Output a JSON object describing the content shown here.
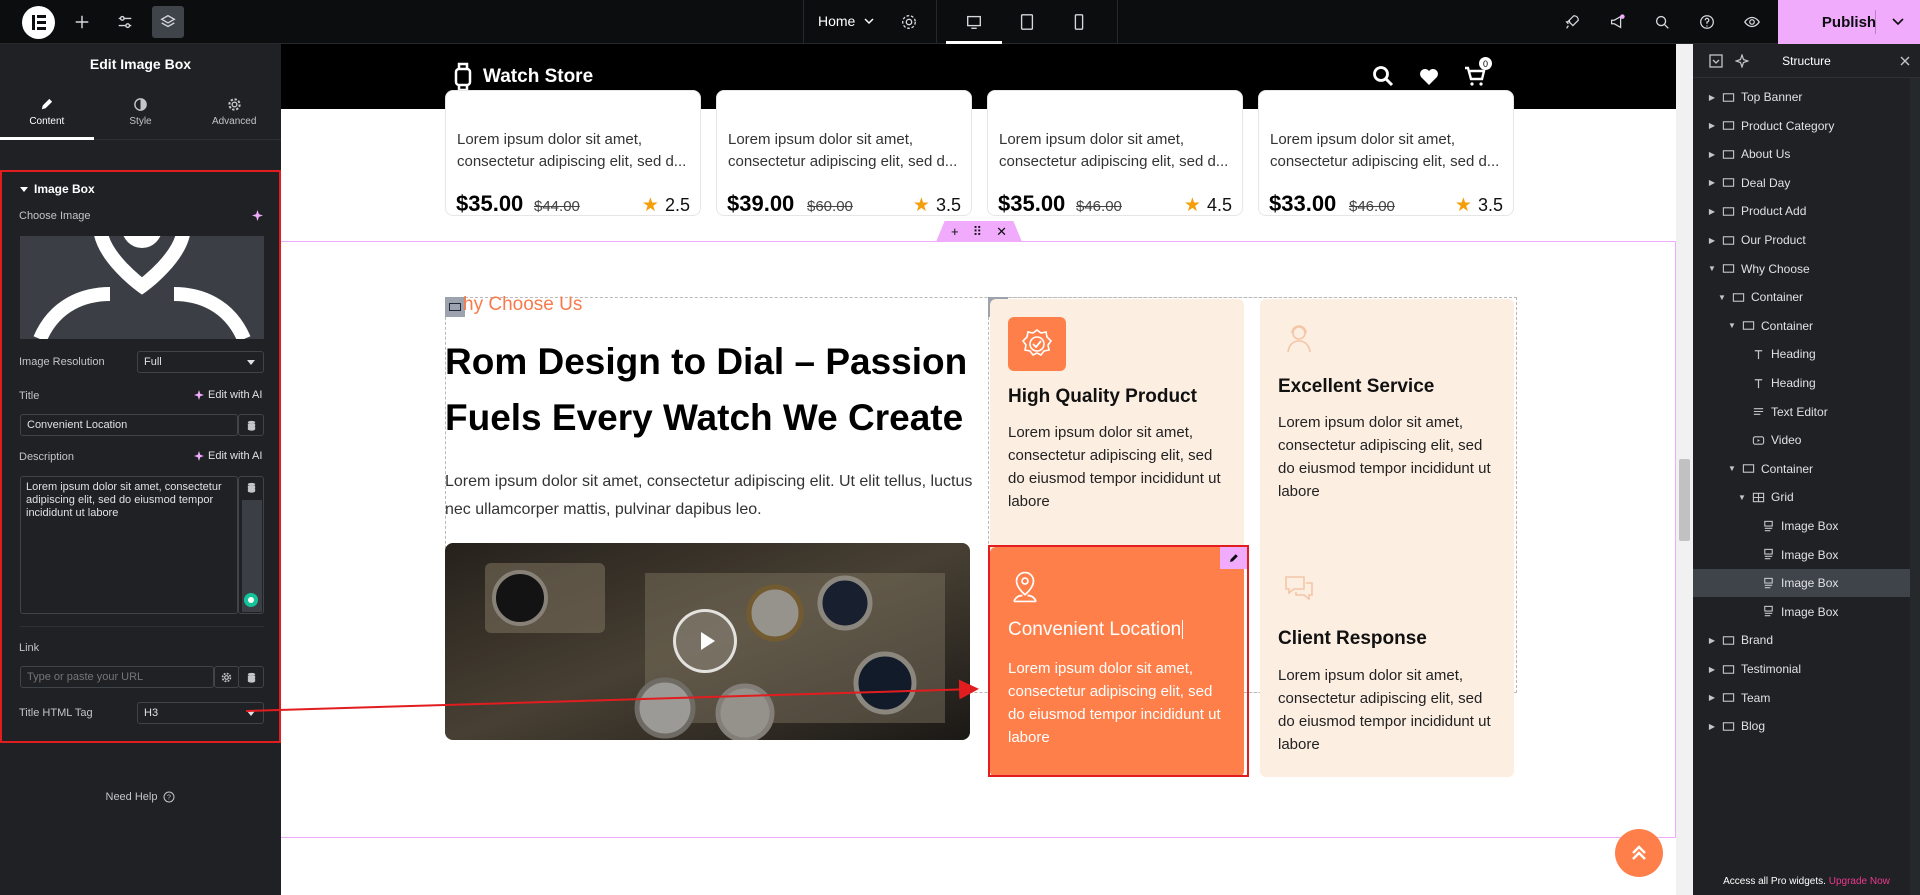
{
  "topbar": {
    "page_name": "Home",
    "publish_label": "Publish",
    "icons": [
      "elementor-logo-icon",
      "plus-icon",
      "sliders-icon",
      "layers-icon",
      "settings-icon",
      "desktop-icon",
      "tablet-icon",
      "mobile-icon",
      "rocket-icon",
      "megaphone-icon",
      "search-icon",
      "help-icon",
      "eye-icon",
      "chevron-down-icon"
    ]
  },
  "left_panel": {
    "title": "Edit Image Box",
    "tabs": [
      {
        "label": "Content",
        "icon": "pencil-icon",
        "active": true
      },
      {
        "label": "Style",
        "icon": "contrast-icon",
        "active": false
      },
      {
        "label": "Advanced",
        "icon": "gear-icon",
        "active": false
      }
    ],
    "section_title": "Image Box",
    "choose_image_label": "Choose Image",
    "image_resolution_label": "Image Resolution",
    "image_resolution_value": "Full",
    "title_label": "Title",
    "title_value": "Convenient Location",
    "edit_with_ai": "Edit with AI",
    "description_label": "Description",
    "description_value": "Lorem ipsum dolor sit amet, consectetur adipiscing elit, sed do eiusmod tempor incididunt ut labore",
    "link_label": "Link",
    "link_placeholder": "Type or paste your URL",
    "title_tag_label": "Title HTML Tag",
    "title_tag_value": "H3",
    "need_help": "Need Help"
  },
  "site": {
    "brand": "Watch Store",
    "cart_count": "0",
    "products": [
      {
        "desc1": "Lorem ipsum dolor sit amet,",
        "desc2": "consectetur adipiscing elit, sed d...",
        "price": "$35.00",
        "old_price": "$44.00",
        "rating": "2.5"
      },
      {
        "desc1": "Lorem ipsum dolor sit amet,",
        "desc2": "consectetur adipiscing elit, sed d...",
        "price": "$39.00",
        "old_price": "$60.00",
        "rating": "3.5"
      },
      {
        "desc1": "Lorem ipsum dolor sit amet,",
        "desc2": "consectetur adipiscing elit, sed d...",
        "price": "$35.00",
        "old_price": "$46.00",
        "rating": "4.5"
      },
      {
        "desc1": "Lorem ipsum dolor sit amet,",
        "desc2": "consectetur adipiscing elit, sed d...",
        "price": "$33.00",
        "old_price": "$46.00",
        "rating": "3.5"
      }
    ],
    "why": {
      "subtitle": "hy Choose Us",
      "title": "Rom Design to Dial – Passion Fuels Every Watch We Create",
      "text": "Lorem ipsum dolor sit amet, consectetur adipiscing elit. Ut elit tellus, luctus nec ullamcorper mattis, pulvinar dapibus leo."
    },
    "features": [
      {
        "title": "High Quality Product",
        "text": "Lorem ipsum dolor sit amet, consectetur adipiscing elit, sed do eiusmod tempor incididunt ut labore",
        "icon": "badge-check-icon"
      },
      {
        "title": "Excellent Service",
        "text": "Lorem ipsum dolor sit amet, consectetur adipiscing elit, sed do eiusmod tempor incididunt ut labore",
        "icon": "support-agent-icon"
      },
      {
        "title": "Convenient Location",
        "text": "Lorem ipsum dolor sit amet, consectetur adipiscing elit, sed do eiusmod tempor incididunt ut labore",
        "icon": "location-pin-icon"
      },
      {
        "title": "Client Response",
        "text": "Lorem ipsum dolor sit amet, consectetur adipiscing elit, sed do eiusmod tempor incididunt ut labore",
        "icon": "chat-bubbles-icon"
      }
    ]
  },
  "navigator": {
    "title": "Structure",
    "items": [
      {
        "label": "Top Banner",
        "depth": 0,
        "arrow": "right",
        "type": "container"
      },
      {
        "label": "Product Category",
        "depth": 0,
        "arrow": "right",
        "type": "container"
      },
      {
        "label": "About Us",
        "depth": 0,
        "arrow": "right",
        "type": "container"
      },
      {
        "label": "Deal Day",
        "depth": 0,
        "arrow": "right",
        "type": "container"
      },
      {
        "label": "Product Add",
        "depth": 0,
        "arrow": "right",
        "type": "container"
      },
      {
        "label": "Our Product",
        "depth": 0,
        "arrow": "right",
        "type": "container"
      },
      {
        "label": "Why Choose",
        "depth": 0,
        "arrow": "down",
        "type": "container"
      },
      {
        "label": "Container",
        "depth": 1,
        "arrow": "down",
        "type": "container"
      },
      {
        "label": "Container",
        "depth": 2,
        "arrow": "down",
        "type": "container"
      },
      {
        "label": "Heading",
        "depth": 3,
        "arrow": "",
        "type": "heading"
      },
      {
        "label": "Heading",
        "depth": 3,
        "arrow": "",
        "type": "heading"
      },
      {
        "label": "Text Editor",
        "depth": 3,
        "arrow": "",
        "type": "text"
      },
      {
        "label": "Video",
        "depth": 3,
        "arrow": "",
        "type": "video"
      },
      {
        "label": "Container",
        "depth": 2,
        "arrow": "down",
        "type": "container"
      },
      {
        "label": "Grid",
        "depth": 3,
        "arrow": "down",
        "type": "grid"
      },
      {
        "label": "Image Box",
        "depth": 4,
        "arrow": "",
        "type": "imagebox"
      },
      {
        "label": "Image Box",
        "depth": 4,
        "arrow": "",
        "type": "imagebox"
      },
      {
        "label": "Image Box",
        "depth": 4,
        "arrow": "",
        "type": "imagebox",
        "selected": true
      },
      {
        "label": "Image Box",
        "depth": 4,
        "arrow": "",
        "type": "imagebox"
      },
      {
        "label": "Brand",
        "depth": 0,
        "arrow": "right",
        "type": "container"
      },
      {
        "label": "Testimonial",
        "depth": 0,
        "arrow": "right",
        "type": "container"
      },
      {
        "label": "Team",
        "depth": 0,
        "arrow": "right",
        "type": "container"
      },
      {
        "label": "Blog",
        "depth": 0,
        "arrow": "right",
        "type": "container"
      }
    ],
    "footer_text": "Access all Pro widgets.",
    "footer_link": "Upgrade Now"
  },
  "colors": {
    "accent_orange": "#ff7f4a",
    "feature_bg": "#fdeee2",
    "editor_pink": "#f0abfc",
    "annotation_red": "#e11d20"
  }
}
